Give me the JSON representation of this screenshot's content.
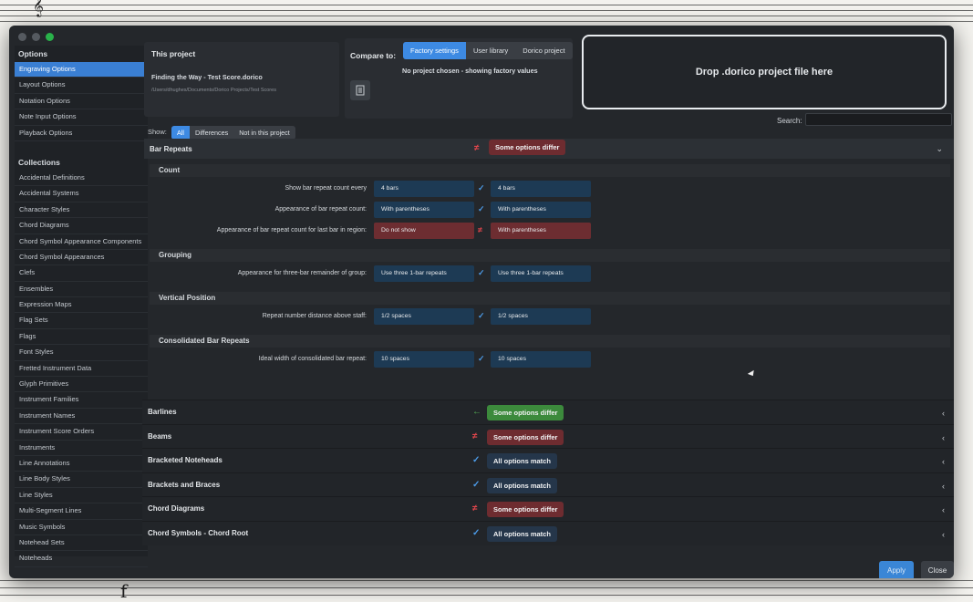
{
  "window": {
    "sidebar": {
      "options_heading": "Options",
      "options": [
        "Engraving Options",
        "Layout Options",
        "Notation Options",
        "Note Input Options",
        "Playback Options"
      ],
      "collections_heading": "Collections",
      "collections": [
        "Accidental Definitions",
        "Accidental Systems",
        "Character Styles",
        "Chord Diagrams",
        "Chord Symbol Appearance Components",
        "Chord Symbol Appearances",
        "Clefs",
        "Ensembles",
        "Expression Maps",
        "Flag Sets",
        "Flags",
        "Font Styles",
        "Fretted Instrument Data",
        "Glyph Primitives",
        "Instrument Families",
        "Instrument Names",
        "Instrument Score Orders",
        "Instruments",
        "Line Annotations",
        "Line Body Styles",
        "Line Styles",
        "Multi-Segment Lines",
        "Music Symbols",
        "Notehead Sets",
        "Noteheads"
      ]
    },
    "this_project": {
      "heading": "This project",
      "file_name": "Finding the Way - Test Score.dorico",
      "path": "/Users/dhughes/Documents/Dorico Projects/Test Scores"
    },
    "compare": {
      "label": "Compare to:",
      "options": [
        "Factory settings",
        "User library",
        "Dorico project"
      ],
      "status": "No project chosen - showing factory values"
    },
    "drop_zone": "Drop .dorico project file here",
    "search_label": "Search:",
    "show": {
      "label": "Show:",
      "options": [
        "All",
        "Differences",
        "Not in this project"
      ]
    },
    "expanded_section": {
      "title": "Bar Repeats",
      "badge": "Some options differ",
      "groups": [
        {
          "title": "Count",
          "rows": [
            {
              "label": "Show bar repeat count every",
              "project": "4 bars",
              "compare": "4 bars",
              "match": true
            },
            {
              "label": "Appearance of bar repeat count:",
              "project": "With parentheses",
              "compare": "With parentheses",
              "match": true
            },
            {
              "label": "Appearance of bar repeat count for last bar in region:",
              "project": "Do not show",
              "compare": "With parentheses",
              "match": false
            }
          ]
        },
        {
          "title": "Grouping",
          "rows": [
            {
              "label": "Appearance for three-bar remainder of group:",
              "project": "Use three 1-bar repeats",
              "compare": "Use three 1-bar repeats",
              "match": true
            }
          ]
        },
        {
          "title": "Vertical Position",
          "rows": [
            {
              "label": "Repeat number distance above staff:",
              "project": "1/2 spaces",
              "compare": "1/2 spaces",
              "match": true
            }
          ]
        },
        {
          "title": "Consolidated Bar Repeats",
          "rows": [
            {
              "label": "Ideal width of consolidated bar repeat:",
              "project": "10 spaces",
              "compare": "10 spaces",
              "match": true
            }
          ]
        }
      ]
    },
    "sections": [
      {
        "title": "Barlines",
        "badge": "Some options differ",
        "state": "green"
      },
      {
        "title": "Beams",
        "badge": "Some options differ",
        "state": "red"
      },
      {
        "title": "Bracketed Noteheads",
        "badge": "All options match",
        "state": "blue"
      },
      {
        "title": "Brackets and Braces",
        "badge": "All options match",
        "state": "blue"
      },
      {
        "title": "Chord Diagrams",
        "badge": "Some options differ",
        "state": "red"
      },
      {
        "title": "Chord Symbols - Chord Root",
        "badge": "All options match",
        "state": "blue"
      }
    ],
    "buttons": {
      "apply": "Apply",
      "close": "Close"
    }
  },
  "colors": {
    "accent": "#3d8ae3",
    "differ": "#6e2c30",
    "match_green": "#3c8a3c",
    "panel": "#24272b"
  }
}
